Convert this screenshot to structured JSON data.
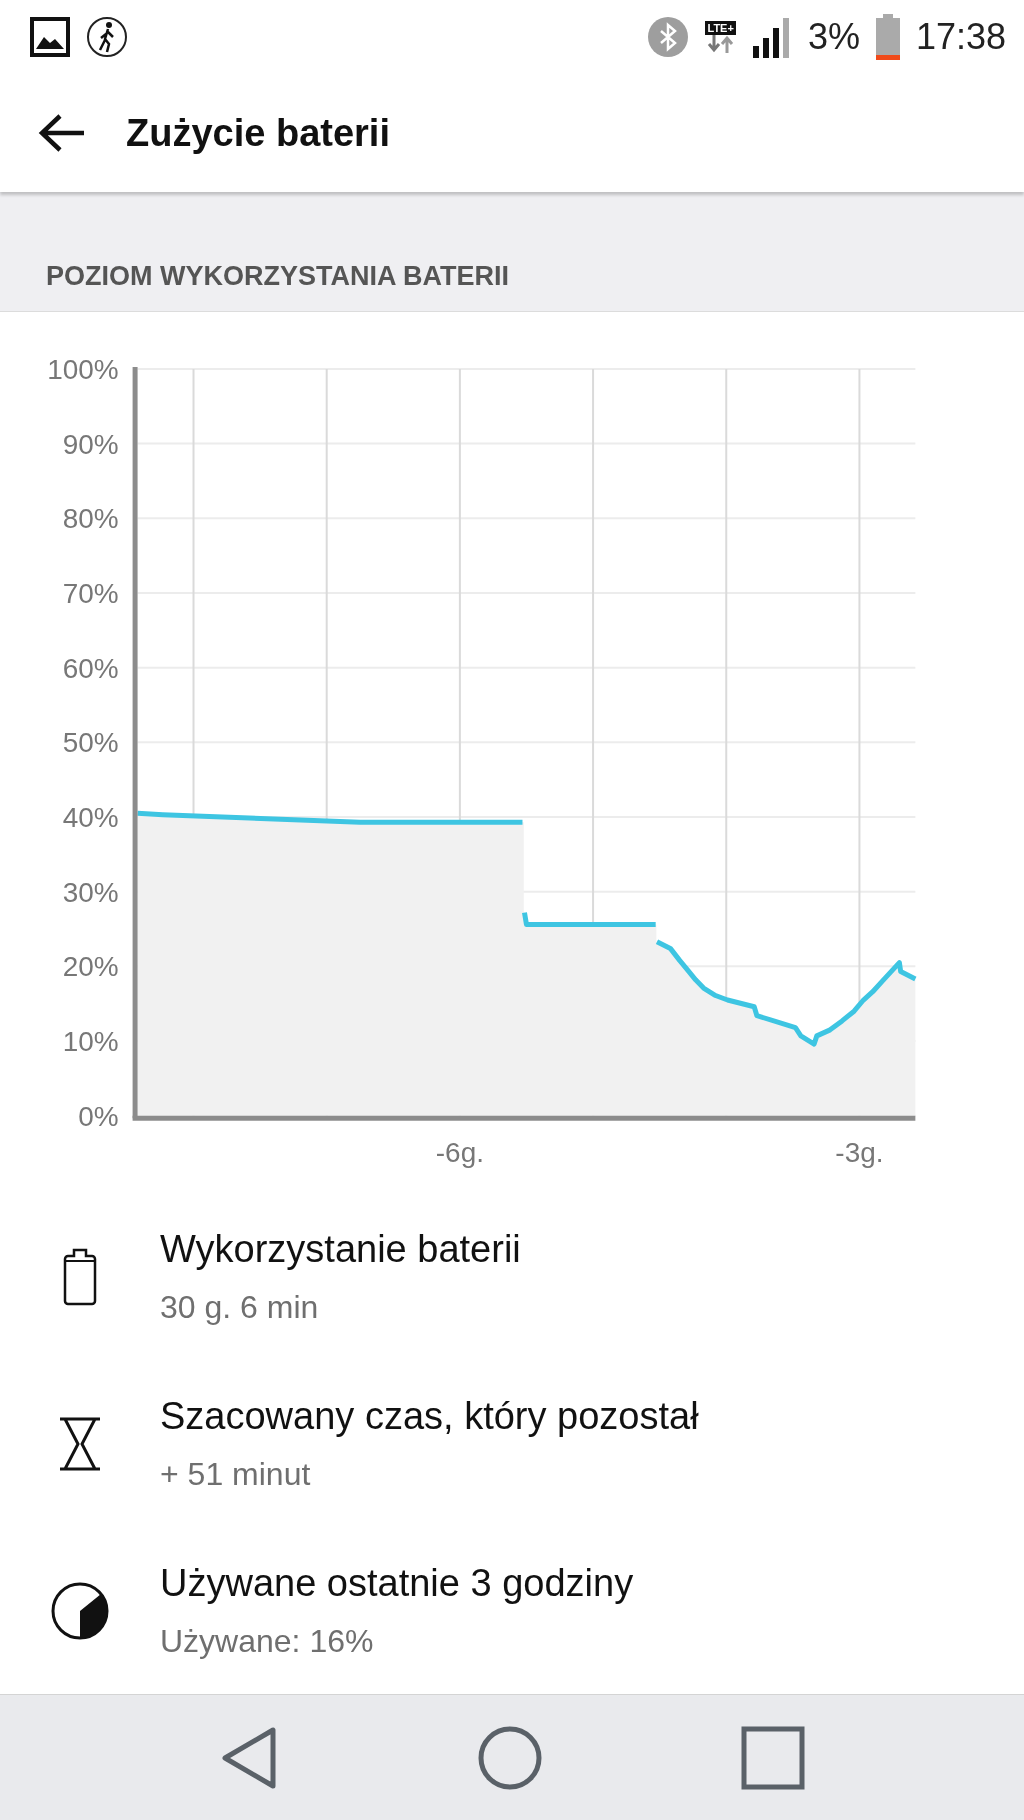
{
  "status_bar": {
    "network": "LTE+",
    "battery_percent": "3%",
    "time": "17:38"
  },
  "toolbar": {
    "title": "Zużycie baterii"
  },
  "section": {
    "header": "POZIOM WYKORZYSTANIA BATERII",
    "chart_data": {
      "type": "area",
      "grid": true,
      "xlim": [
        -8.42,
        -2.58
      ],
      "ylim": [
        0,
        100
      ],
      "xticks": [
        {
          "value": -6,
          "label": "-6g."
        },
        {
          "value": -3,
          "label": "-3g."
        }
      ],
      "yticks": [
        {
          "value": 0,
          "label": "0%"
        },
        {
          "value": 10,
          "label": "10%"
        },
        {
          "value": 20,
          "label": "20%"
        },
        {
          "value": 30,
          "label": "30%"
        },
        {
          "value": 40,
          "label": "40%"
        },
        {
          "value": 50,
          "label": "50%"
        },
        {
          "value": 60,
          "label": "60%"
        },
        {
          "value": 70,
          "label": "70%"
        },
        {
          "value": 80,
          "label": "80%"
        },
        {
          "value": 90,
          "label": "90%"
        },
        {
          "value": 100,
          "label": "100%"
        }
      ],
      "x": [
        -8.42,
        -8.23,
        -6.75,
        -5.53,
        -5.52,
        -5.515,
        -5.5,
        -4.53,
        -4.525,
        -4.52,
        -4.42,
        -4.35,
        -4.28,
        -4.23,
        -4.17,
        -4.08,
        -3.99,
        -3.79,
        -3.77,
        -3.48,
        -3.44,
        -3.34,
        -3.32,
        -3.22,
        -3.13,
        -3.04,
        -2.97,
        -2.9,
        -2.83,
        -2.7,
        -2.69,
        -2.58
      ],
      "series": [
        {
          "color": "#3ec5e2",
          "values": [
            40.5,
            40.3,
            39.3,
            39.3,
            null,
            27.2,
            25.6,
            25.6,
            null,
            23.3,
            22.4,
            20.8,
            19.3,
            18.2,
            17.1,
            16.1,
            15.5,
            14.6,
            13.4,
            11.8,
            10.7,
            9.6,
            10.7,
            11.5,
            12.7,
            14.0,
            15.5,
            16.6,
            18.0,
            20.5,
            19.3,
            18.3
          ]
        }
      ]
    }
  },
  "items": [
    {
      "kind": "battery",
      "title": "Wykorzystanie baterii",
      "subtitle": "30 g. 6 min"
    },
    {
      "kind": "hourglass",
      "title": "Szacowany czas, który pozostał",
      "subtitle": "+ 51 minut"
    },
    {
      "kind": "pie",
      "title": "Używane ostatnie 3 godziny",
      "subtitle": "Używane: 16%"
    }
  ]
}
